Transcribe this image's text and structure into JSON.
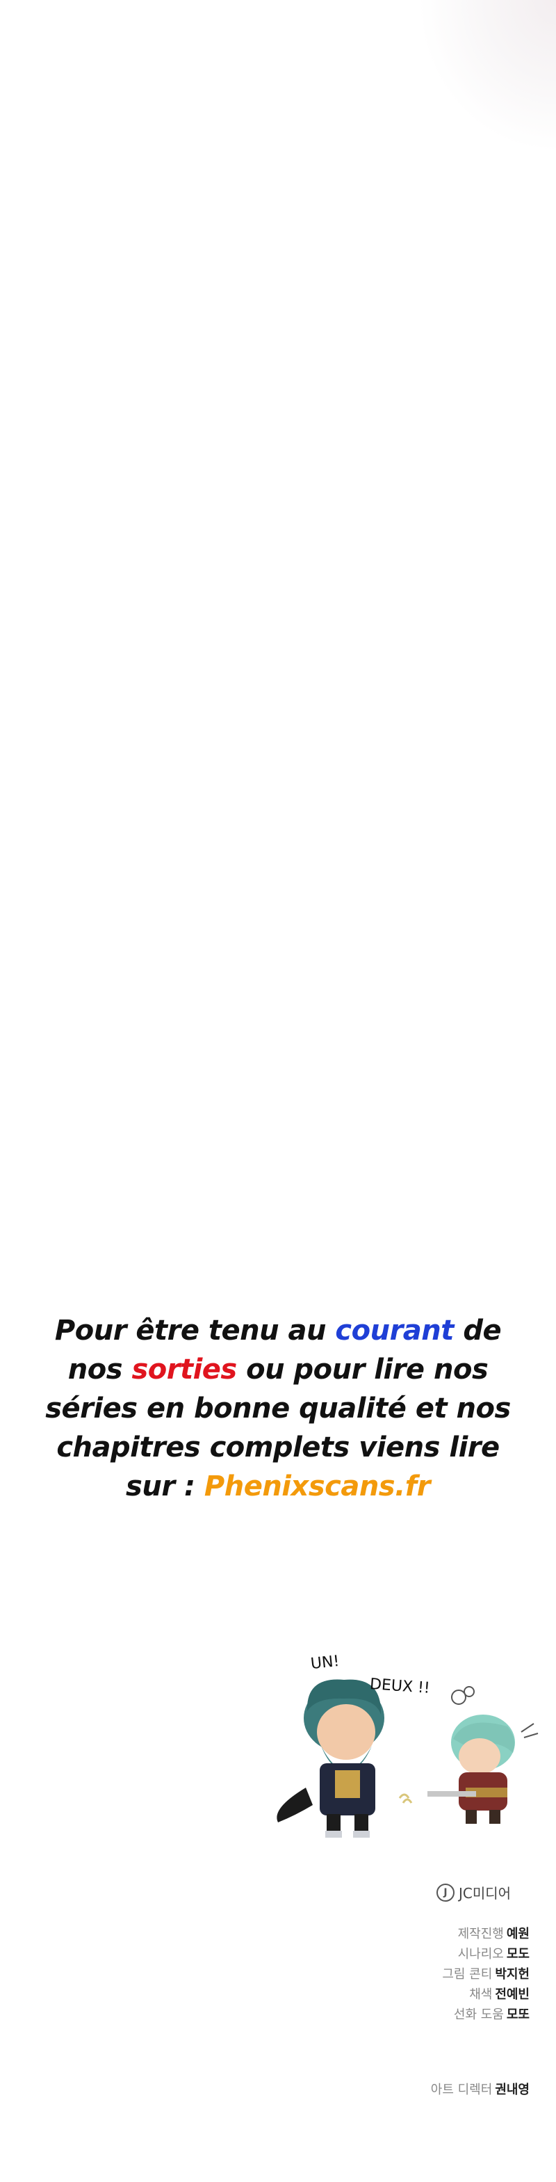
{
  "promo": {
    "part1": "Pour être tenu au ",
    "courant": "courant",
    "part2": " de nos ",
    "sorties": "sorties",
    "part3": " ou pour lire nos séries en bonne qualité et nos chapitres complets viens lire sur : ",
    "site": "Phenixscans.fr"
  },
  "illustration": {
    "sfx_un": "UN!",
    "sfx_deux": "DEUX !!"
  },
  "publisher": {
    "logo_glyph": "J",
    "name": "JC미디어"
  },
  "credits": [
    {
      "role": "제작진행",
      "name": "예원"
    },
    {
      "role": "시나리오",
      "name": "모도"
    },
    {
      "role": "그림 콘티",
      "name": "박지헌"
    },
    {
      "role": "채색",
      "name": "전예빈"
    },
    {
      "role": "선화 도움",
      "name": "모또"
    }
  ],
  "art_director": {
    "role": "아트 디렉터",
    "name": "권내영"
  },
  "colors": {
    "blue": "#1f3fd6",
    "red": "#e0141e",
    "orange": "#f39a0b",
    "text": "#111111"
  }
}
